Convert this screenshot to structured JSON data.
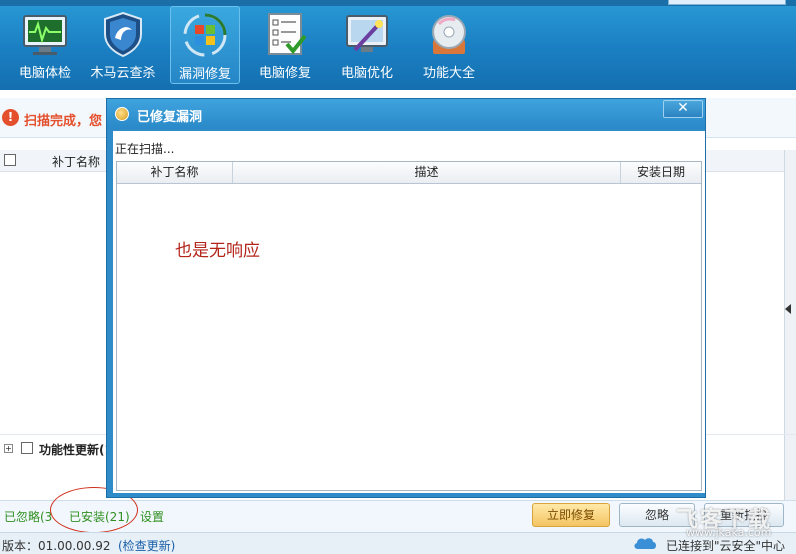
{
  "toolbar": {
    "items": [
      {
        "label": "电脑体检",
        "icon": "monitor-checkup-icon"
      },
      {
        "label": "木马云查杀",
        "icon": "shield-icon"
      },
      {
        "label": "漏洞修复",
        "icon": "windows-logo-icon"
      },
      {
        "label": "电脑修复",
        "icon": "checklist-icon"
      },
      {
        "label": "电脑优化",
        "icon": "magic-wand-screen-icon"
      },
      {
        "label": "功能大全",
        "icon": "disc-toolbox-icon"
      }
    ],
    "active_index": 2
  },
  "main": {
    "status_text": "扫描完成，您",
    "list_header": {
      "col_name": "补丁名称"
    },
    "functional_update_row": "功能性更新(1"
  },
  "dialog": {
    "title": "已修复漏洞",
    "close_label": "✕",
    "status": "正在扫描...",
    "columns": [
      "补丁名称",
      "描述",
      "安装日期"
    ],
    "annotation": "也是无响应"
  },
  "bottom": {
    "ignored_link": "已忽略(3",
    "installed_link": "已安装(21)",
    "settings_link": "设置",
    "fix_button": "立即修复",
    "ignore_button": "忽略",
    "rescan_button": "重新扫描"
  },
  "statusbar": {
    "version": "版本：01.00.00.92",
    "check_update": "(检查更新)",
    "cloud_status": "已连接到\"云安全\"中心"
  },
  "watermark": {
    "big_text": "飞客下载",
    "url": "www.jkaka.com"
  },
  "colors": {
    "toolbar_blue": "#1a7fc2",
    "dialog_blue": "#2f8cc9",
    "alert_red": "#e4502d",
    "link_green": "#2f8f20",
    "annotation_red": "#b3241a"
  }
}
